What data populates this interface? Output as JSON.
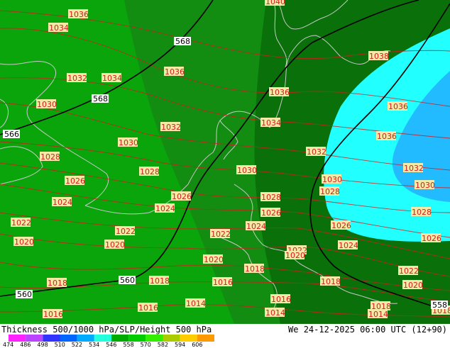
{
  "footer": {
    "title": "Thickness 500/1000 hPa/SLP/Height 500 hPa",
    "valid_time": "We 24-12-2025 06:00 UTC (12+90)",
    "scale_values": [
      "474",
      "486",
      "498",
      "510",
      "522",
      "534",
      "546",
      "558",
      "570",
      "582",
      "594",
      "606"
    ],
    "scale_colors": [
      "#ff22ff",
      "#bb44ff",
      "#3333ff",
      "#0066ff",
      "#00aaff",
      "#22ffdd",
      "#00aa00",
      "#00cc00",
      "#33ee00",
      "#aacc00",
      "#ffcc00",
      "#ff9900"
    ]
  },
  "map": {
    "colors": {
      "band_546": "#0aa50a",
      "band_552": "#128d12",
      "band_558": "#0a700a",
      "band_522": "#22ffff",
      "band_510": "#22bbff",
      "coastline": "#c8c8c8",
      "isobar": "#d21d1d",
      "height_contour": "#000000"
    },
    "isobar_labels": [
      "1036",
      "1034",
      "1032",
      "1034",
      "1030",
      "1036",
      "1032",
      "1030",
      "1028",
      "1026",
      "1024",
      "1022",
      "1020",
      "1018",
      "1016",
      "1040",
      "1038",
      "1036",
      "1036",
      "1034",
      "1032",
      "1030",
      "1028",
      "1026",
      "1024",
      "1022",
      "1020",
      "1018",
      "1016",
      "1014",
      "1036",
      "1034",
      "1032",
      "1030",
      "1028",
      "1026",
      "1024",
      "1022",
      "1020",
      "1018",
      "1016",
      "1014",
      "1026",
      "1030",
      "1032",
      "1028",
      "1026",
      "1024",
      "1022",
      "1020",
      "1018",
      "1016",
      "1014",
      "1018",
      "1028",
      "1026",
      "1024",
      "1022",
      "1020",
      "1018",
      "1016",
      "1014"
    ],
    "height_labels": [
      "568",
      "568",
      "566",
      "560",
      "560",
      "558"
    ]
  }
}
